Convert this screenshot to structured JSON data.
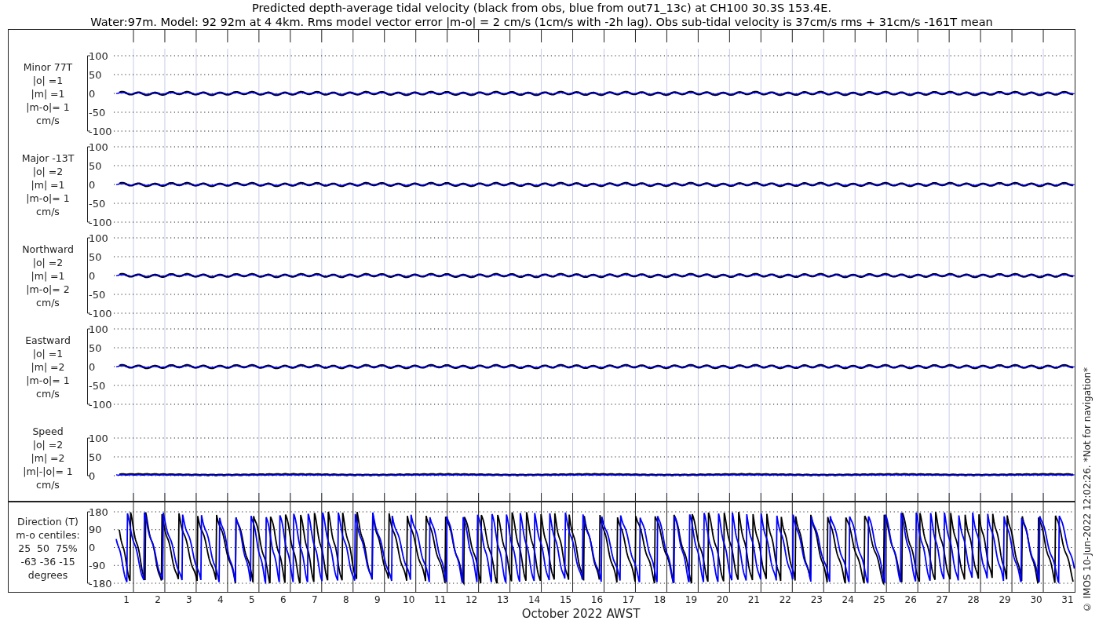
{
  "title_lines": [
    "Predicted depth-average tidal velocity (black from obs, blue from out71_13c) at CH100 30.3S 153.4E.",
    "Water:97m. Model: 92 92m at 4 4km. Rms model vector error |m-o| = 2 cm/s (1cm/s with -2h lag). Obs sub-tidal velocity is 37cm/s rms + 31cm/s -161T mean"
  ],
  "panels": [
    {
      "kind": "velocity",
      "label_lines": [
        "Minor 77T",
        "|o| =1",
        "|m| =1",
        "|m-o|= 1",
        "cm/s"
      ],
      "yticks": [
        "100",
        "50",
        "0",
        "-50",
        "-100"
      ],
      "traces": [
        {
          "color": "#000000"
        },
        {
          "color": "#0000ff"
        }
      ]
    },
    {
      "kind": "velocity",
      "label_lines": [
        "Major -13T",
        "|o| =2",
        "|m| =1",
        "|m-o|= 1",
        "cm/s"
      ],
      "yticks": [
        "100",
        "50",
        "0",
        "-50",
        "-100"
      ],
      "traces": [
        {
          "color": "#000000"
        },
        {
          "color": "#0000ff"
        }
      ]
    },
    {
      "kind": "velocity",
      "label_lines": [
        "Northward",
        "|o| =2",
        "|m| =1",
        "|m-o|= 2",
        "cm/s"
      ],
      "yticks": [
        "100",
        "50",
        "0",
        "-50",
        "-100"
      ],
      "traces": [
        {
          "color": "#000000"
        },
        {
          "color": "#0000ff"
        }
      ]
    },
    {
      "kind": "velocity",
      "label_lines": [
        "Eastward",
        "|o| =1",
        "|m| =2",
        "|m-o|= 1",
        "cm/s"
      ],
      "yticks": [
        "100",
        "50",
        "0",
        "-50",
        "-100"
      ],
      "traces": [
        {
          "color": "#000000"
        },
        {
          "color": "#0000ff"
        }
      ]
    },
    {
      "kind": "speed",
      "label_lines": [
        "Speed",
        "|o| =2",
        "|m| =2",
        "|m|-|o|= 1",
        "cm/s"
      ],
      "yticks": [
        "100",
        "50",
        "0"
      ],
      "traces": [
        {
          "color": "#000000"
        },
        {
          "color": "#0000ff"
        }
      ]
    },
    {
      "kind": "direction",
      "label_lines": [
        "Direction (T)",
        "m-o centiles:",
        "25  50  75%",
        "-63 -36 -15",
        "degrees"
      ],
      "yticks": [
        "180",
        "90",
        "0",
        "-90",
        "-180"
      ],
      "traces": [
        {
          "color": "#000000"
        },
        {
          "color": "#0000ff"
        }
      ]
    }
  ],
  "x_ticks": [
    "1",
    "2",
    "3",
    "4",
    "5",
    "6",
    "7",
    "8",
    "9",
    "10",
    "11",
    "12",
    "13",
    "14",
    "15",
    "16",
    "17",
    "18",
    "19",
    "20",
    "21",
    "22",
    "23",
    "24",
    "25",
    "26",
    "27",
    "28",
    "29",
    "30",
    "31"
  ],
  "xlabel": "October 2022 AWST",
  "side_note": "© IMOS 10-Jun-2022 12:02:26. *Not for navigation*"
}
